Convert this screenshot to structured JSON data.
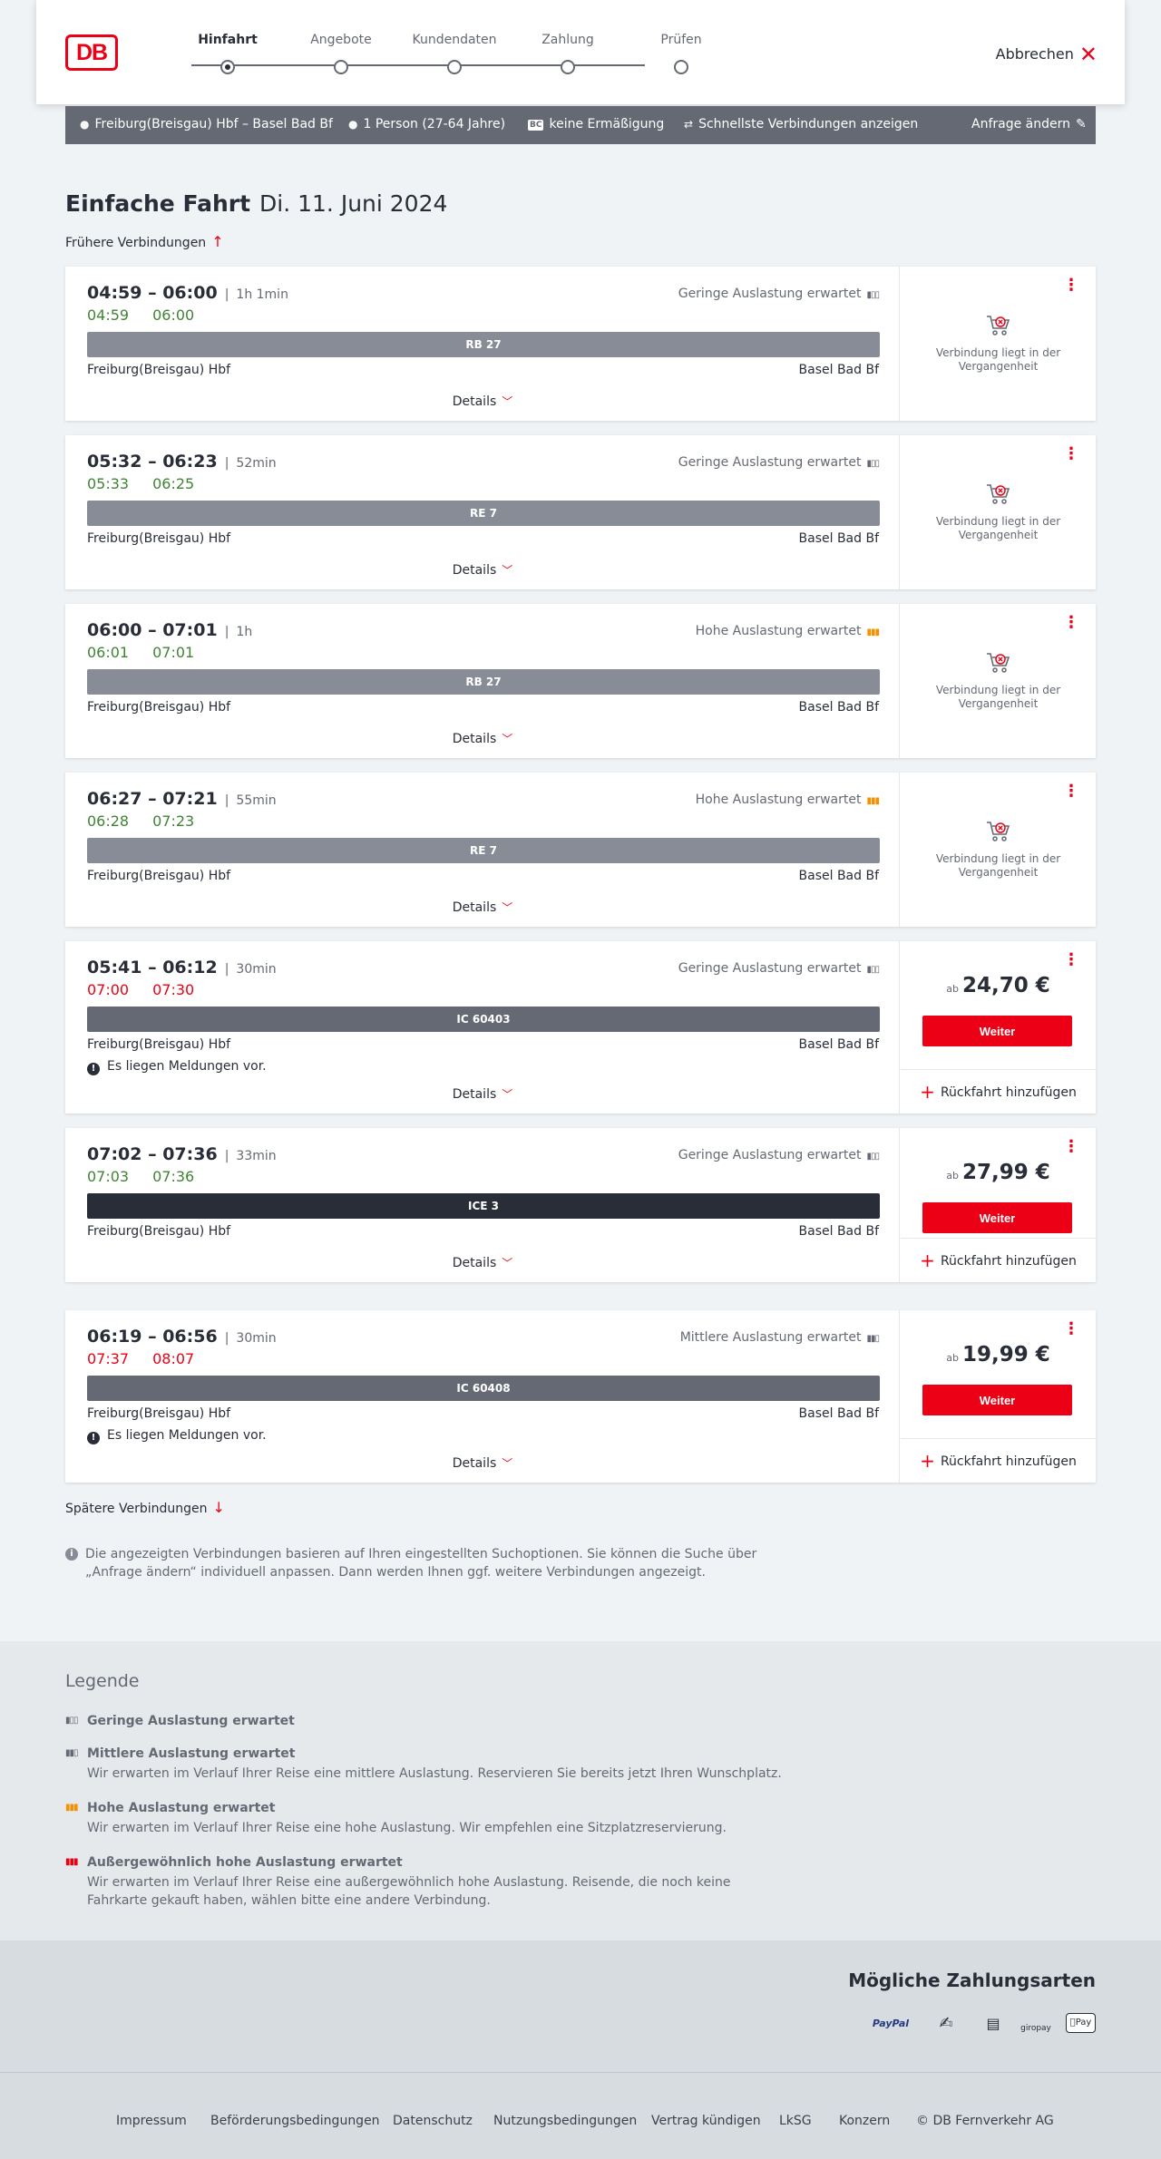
{
  "header": {
    "logo_text": "DB",
    "steps": [
      {
        "label": "Hinfahrt",
        "active": true
      },
      {
        "label": "Angebote",
        "active": false
      },
      {
        "label": "Kundendaten",
        "active": false
      },
      {
        "label": "Zahlung",
        "active": false
      },
      {
        "label": "Prüfen",
        "active": false
      }
    ],
    "cancel_label": "Abbrechen"
  },
  "search_bar": {
    "route": "Freiburg(Breisgau) Hbf – Basel Bad Bf",
    "passengers": "1 Person (27-64 Jahre)",
    "bc_badge": "BC",
    "discount": "keine Ermäßigung",
    "mode": "Schnellste Verbindungen anzeigen",
    "change_label": "Anfrage ändern"
  },
  "page": {
    "title_bold": "Einfache Fahrt",
    "title_date": "Di. 11. Juni 2024",
    "earlier_label": "Frühere Verbindungen",
    "later_label": "Spätere Verbindungen",
    "info_text": "Die angezeigten Verbindungen basieren auf Ihren eingestellten Suchoptionen. Sie können die Suche über „Anfrage ändern“ individuell anpassen. Dann werden Ihnen ggf. weitere Verbindungen angezeigt."
  },
  "connections": [
    {
      "times": "04:59 – 06:00",
      "duration": "1h 1min",
      "rt_dep": "04:59",
      "rt_arr": "06:00",
      "rt_status": "ok",
      "occupancy": "Geringe Auslastung erwartet",
      "occ_level": 1,
      "train": "RB 27",
      "train_style": "regional",
      "from": "Freiburg(Breisgau) Hbf",
      "to": "Basel Bad Bf",
      "message": "",
      "details_label": "Details",
      "past_text": "Verbindung liegt in der Vergangenheit",
      "price_prefix": "",
      "price": "",
      "button_label": "",
      "return_label": ""
    },
    {
      "times": "05:32 – 06:23",
      "duration": "52min",
      "rt_dep": "05:33",
      "rt_arr": "06:25",
      "rt_status": "ok",
      "occupancy": "Geringe Auslastung erwartet",
      "occ_level": 1,
      "train": "RE 7",
      "train_style": "regional",
      "from": "Freiburg(Breisgau) Hbf",
      "to": "Basel Bad Bf",
      "message": "",
      "details_label": "Details",
      "past_text": "Verbindung liegt in der Vergangenheit",
      "price_prefix": "",
      "price": "",
      "button_label": "",
      "return_label": ""
    },
    {
      "times": "06:00 – 07:01",
      "duration": "1h",
      "rt_dep": "06:01",
      "rt_arr": "07:01",
      "rt_status": "ok",
      "occupancy": "Hohe Auslastung erwartet",
      "occ_level": 3,
      "train": "RB 27",
      "train_style": "regional",
      "from": "Freiburg(Breisgau) Hbf",
      "to": "Basel Bad Bf",
      "message": "",
      "details_label": "Details",
      "past_text": "Verbindung liegt in der Vergangenheit",
      "price_prefix": "",
      "price": "",
      "button_label": "",
      "return_label": ""
    },
    {
      "times": "06:27 – 07:21",
      "duration": "55min",
      "rt_dep": "06:28",
      "rt_arr": "07:23",
      "rt_status": "ok",
      "occupancy": "Hohe Auslastung erwartet",
      "occ_level": 3,
      "train": "RE 7",
      "train_style": "regional",
      "from": "Freiburg(Breisgau) Hbf",
      "to": "Basel Bad Bf",
      "message": "",
      "details_label": "Details",
      "past_text": "Verbindung liegt in der Vergangenheit",
      "price_prefix": "",
      "price": "",
      "button_label": "",
      "return_label": ""
    },
    {
      "times": "05:41 – 06:12",
      "duration": "30min",
      "rt_dep": "07:00",
      "rt_arr": "07:30",
      "rt_status": "late",
      "occupancy": "Geringe Auslastung erwartet",
      "occ_level": 1,
      "train": "IC 60403",
      "train_style": "ic",
      "from": "Freiburg(Breisgau) Hbf",
      "to": "Basel Bad Bf",
      "message": "Es liegen Meldungen vor.",
      "details_label": "Details",
      "past_text": "",
      "price_prefix": "ab",
      "price": "24,70 €",
      "button_label": "Weiter",
      "return_label": "Rückfahrt hinzufügen"
    },
    {
      "times": "07:02 – 07:36",
      "duration": "33min",
      "rt_dep": "07:03",
      "rt_arr": "07:36",
      "rt_status": "ok",
      "occupancy": "Geringe Auslastung erwartet",
      "occ_level": 1,
      "train": "ICE 3",
      "train_style": "ice",
      "from": "Freiburg(Breisgau) Hbf",
      "to": "Basel Bad Bf",
      "message": "",
      "details_label": "Details",
      "past_text": "",
      "price_prefix": "ab",
      "price": "27,99 €",
      "button_label": "Weiter",
      "return_label": "Rückfahrt hinzufügen"
    },
    {
      "times": "06:19 – 06:56",
      "duration": "30min",
      "rt_dep": "07:37",
      "rt_arr": "08:07",
      "rt_status": "late",
      "occupancy": "Mittlere Auslastung erwartet",
      "occ_level": 2,
      "train": "IC 60408",
      "train_style": "ic",
      "from": "Freiburg(Breisgau) Hbf",
      "to": "Basel Bad Bf",
      "message": "Es liegen Meldungen vor.",
      "details_label": "Details",
      "past_text": "",
      "price_prefix": "ab",
      "price": "19,99 €",
      "button_label": "Weiter",
      "return_label": "Rückfahrt hinzufügen"
    }
  ],
  "legend": {
    "title": "Legende",
    "items": [
      {
        "title": "Geringe Auslastung erwartet",
        "desc": "",
        "color": "#646973"
      },
      {
        "title": "Mittlere Auslastung erwartet",
        "desc": "Wir erwarten im Verlauf Ihrer Reise eine mittlere Auslastung. Reservieren Sie bereits jetzt Ihren Wunschplatz.",
        "color": "#646973"
      },
      {
        "title": "Hohe Auslastung erwartet",
        "desc": "Wir erwarten im Verlauf Ihrer Reise eine hohe Auslastung. Wir empfehlen eine Sitzplatzreservierung.",
        "color": "#f39200"
      },
      {
        "title": "Außergewöhnlich hohe Auslastung erwartet",
        "desc": "Wir erwarten im Verlauf Ihrer Reise eine außergewöhnlich hohe Auslastung. Reisende, die noch keine Fahrkarte gekauft haben, wählen bitte eine andere Verbindung.",
        "color": "#ec0016"
      }
    ]
  },
  "payment": {
    "title": "Mögliche Zahlungsarten",
    "methods": [
      "PayPal",
      "giropay",
      "Pay"
    ]
  },
  "footer": {
    "links": [
      "Impressum",
      "Beförderungsbedingungen",
      "Datenschutz",
      "Nutzungsbedingungen",
      "Vertrag kündigen",
      "LkSG",
      "Konzern",
      "© DB Fernverkehr AG"
    ]
  }
}
